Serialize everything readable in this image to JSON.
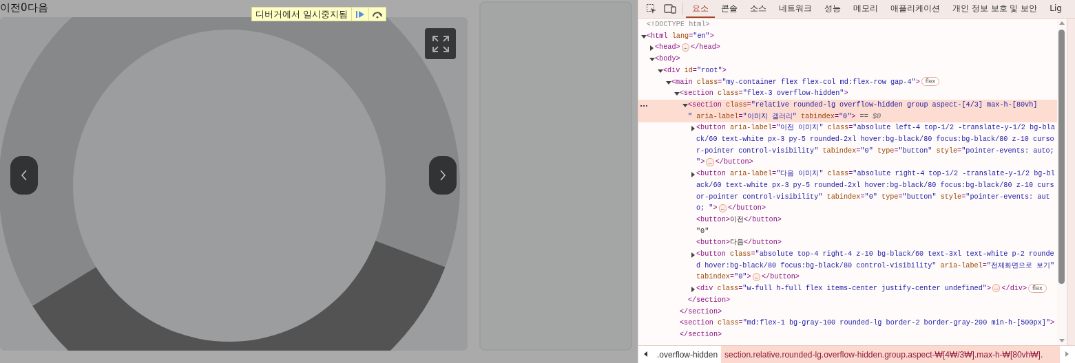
{
  "page": {
    "prev_label": "이전",
    "counter": "0",
    "next_label": "다음"
  },
  "debugger_badge": {
    "text": "디버거에서 일시중지됨"
  },
  "devtools": {
    "tabs": [
      {
        "label": "요소",
        "selected": true
      },
      {
        "label": "콘솔",
        "selected": false
      },
      {
        "label": "소스",
        "selected": false
      },
      {
        "label": "네트워크",
        "selected": false
      },
      {
        "label": "성능",
        "selected": false
      },
      {
        "label": "메모리",
        "selected": false
      },
      {
        "label": "애플리케이션",
        "selected": false
      },
      {
        "label": "개인 정보 보호 및 보안",
        "selected": false
      },
      {
        "label": "Lig",
        "selected": false
      }
    ],
    "tree": [
      {
        "segments": [
          {
            "kind": "comment",
            "text": "<!DOCTYPE html>"
          }
        ]
      },
      {
        "segments": [
          {
            "kind": "tag",
            "text": "<html"
          },
          {
            "kind": "attr",
            "text": " lang"
          },
          {
            "kind": "tag",
            "text": "="
          },
          {
            "kind": "value",
            "text": "\"en\""
          },
          {
            "kind": "tag",
            "text": ">"
          }
        ],
        "expanded": true,
        "children": [
          {
            "segments": [
              {
                "kind": "tag",
                "text": "<head>"
              },
              {
                "kind": "ellipsis",
                "text": "…"
              },
              {
                "kind": "tag",
                "text": "</head>"
              }
            ],
            "expanded": false
          },
          {
            "segments": [
              {
                "kind": "tag",
                "text": "<body>"
              }
            ],
            "expanded": true,
            "children": [
              {
                "segments": [
                  {
                    "kind": "tag",
                    "text": "<div"
                  },
                  {
                    "kind": "attr",
                    "text": " id"
                  },
                  {
                    "kind": "tag",
                    "text": "="
                  },
                  {
                    "kind": "value",
                    "text": "\"root\""
                  },
                  {
                    "kind": "tag",
                    "text": ">"
                  }
                ],
                "expanded": true,
                "children": [
                  {
                    "segments": [
                      {
                        "kind": "tag",
                        "text": "<main"
                      },
                      {
                        "kind": "attr",
                        "text": " class"
                      },
                      {
                        "kind": "tag",
                        "text": "="
                      },
                      {
                        "kind": "value",
                        "text": "\"my-container flex flex-col md:flex-row gap-4\""
                      },
                      {
                        "kind": "tag",
                        "text": ">"
                      },
                      {
                        "kind": "badge",
                        "text": "flex"
                      }
                    ],
                    "expanded": true,
                    "children": [
                      {
                        "segments": [
                          {
                            "kind": "tag",
                            "text": "<section"
                          },
                          {
                            "kind": "attr",
                            "text": " class"
                          },
                          {
                            "kind": "tag",
                            "text": "="
                          },
                          {
                            "kind": "value",
                            "text": "\"flex-3 overflow-hidden\""
                          },
                          {
                            "kind": "tag",
                            "text": ">"
                          }
                        ],
                        "expanded": true,
                        "children": [
                          {
                            "segments": [
                              {
                                "kind": "tag",
                                "text": "<section"
                              },
                              {
                                "kind": "attr",
                                "text": " class"
                              },
                              {
                                "kind": "tag",
                                "text": "="
                              },
                              {
                                "kind": "value",
                                "text": "\"relative rounded-lg overflow-hidden group aspect-[4/3] max-h-[80vh]      \""
                              },
                              {
                                "kind": "attr",
                                "text": " aria-label"
                              },
                              {
                                "kind": "tag",
                                "text": "="
                              },
                              {
                                "kind": "value",
                                "text": "\"이미지 갤러리\""
                              },
                              {
                                "kind": "attr",
                                "text": " tabindex"
                              },
                              {
                                "kind": "tag",
                                "text": "="
                              },
                              {
                                "kind": "value",
                                "text": "\"0\""
                              },
                              {
                                "kind": "tag",
                                "text": ">"
                              },
                              {
                                "kind": "ref",
                                "text": " == $0"
                              }
                            ],
                            "expanded": true,
                            "selected": true,
                            "children": [
                              {
                                "segments": [
                                  {
                                    "kind": "tag",
                                    "text": "<button"
                                  },
                                  {
                                    "kind": "attr",
                                    "text": " aria-label"
                                  },
                                  {
                                    "kind": "tag",
                                    "text": "="
                                  },
                                  {
                                    "kind": "value",
                                    "text": "\"이전 이미지\""
                                  },
                                  {
                                    "kind": "attr",
                                    "text": " class"
                                  },
                                  {
                                    "kind": "tag",
                                    "text": "="
                                  },
                                  {
                                    "kind": "value",
                                    "text": "\"absolute left-4 top-1/2 -translate-y-1/2 bg-black/60 text-white px-3 py-5 rounded-2xl hover:bg-black/80 focus:bg-black/80 z-10 cursor-pointer control-visibility\""
                                  },
                                  {
                                    "kind": "attr",
                                    "text": " tabindex"
                                  },
                                  {
                                    "kind": "tag",
                                    "text": "="
                                  },
                                  {
                                    "kind": "value",
                                    "text": "\"0\""
                                  },
                                  {
                                    "kind": "attr",
                                    "text": " type"
                                  },
                                  {
                                    "kind": "tag",
                                    "text": "="
                                  },
                                  {
                                    "kind": "value",
                                    "text": "\"button\""
                                  },
                                  {
                                    "kind": "attr",
                                    "text": " style"
                                  },
                                  {
                                    "kind": "tag",
                                    "text": "="
                                  },
                                  {
                                    "kind": "value",
                                    "text": "\"pointer-events: auto; \""
                                  },
                                  {
                                    "kind": "tag",
                                    "text": ">"
                                  },
                                  {
                                    "kind": "ellipsis",
                                    "text": "…"
                                  },
                                  {
                                    "kind": "tag",
                                    "text": "</button>"
                                  }
                                ],
                                "expanded": false
                              },
                              {
                                "segments": [
                                  {
                                    "kind": "tag",
                                    "text": "<button"
                                  },
                                  {
                                    "kind": "attr",
                                    "text": " aria-label"
                                  },
                                  {
                                    "kind": "tag",
                                    "text": "="
                                  },
                                  {
                                    "kind": "value",
                                    "text": "\"다음 이미지\""
                                  },
                                  {
                                    "kind": "attr",
                                    "text": " class"
                                  },
                                  {
                                    "kind": "tag",
                                    "text": "="
                                  },
                                  {
                                    "kind": "value",
                                    "text": "\"absolute right-4 top-1/2 -translate-y-1/2 bg-black/60 text-white px-3 py-5 rounded-2xl hover:bg-black/80 focus:bg-black/80 z-10 cursor-pointer control-visibility\""
                                  },
                                  {
                                    "kind": "attr",
                                    "text": " tabindex"
                                  },
                                  {
                                    "kind": "tag",
                                    "text": "="
                                  },
                                  {
                                    "kind": "value",
                                    "text": "\"0\""
                                  },
                                  {
                                    "kind": "attr",
                                    "text": " type"
                                  },
                                  {
                                    "kind": "tag",
                                    "text": "="
                                  },
                                  {
                                    "kind": "value",
                                    "text": "\"button\""
                                  },
                                  {
                                    "kind": "attr",
                                    "text": " style"
                                  },
                                  {
                                    "kind": "tag",
                                    "text": "="
                                  },
                                  {
                                    "kind": "value",
                                    "text": "\"pointer-events: auto; \""
                                  },
                                  {
                                    "kind": "tag",
                                    "text": ">"
                                  },
                                  {
                                    "kind": "ellipsis",
                                    "text": "…"
                                  },
                                  {
                                    "kind": "tag",
                                    "text": "</button>"
                                  }
                                ],
                                "expanded": false
                              },
                              {
                                "segments": [
                                  {
                                    "kind": "tag",
                                    "text": "<button>"
                                  },
                                  {
                                    "kind": "text",
                                    "text": "이전"
                                  },
                                  {
                                    "kind": "tag",
                                    "text": "</button>"
                                  }
                                ]
                              },
                              {
                                "segments": [
                                  {
                                    "kind": "text",
                                    "text": "\"0\""
                                  }
                                ]
                              },
                              {
                                "segments": [
                                  {
                                    "kind": "tag",
                                    "text": "<button>"
                                  },
                                  {
                                    "kind": "text",
                                    "text": "다음"
                                  },
                                  {
                                    "kind": "tag",
                                    "text": "</button>"
                                  }
                                ]
                              },
                              {
                                "segments": [
                                  {
                                    "kind": "tag",
                                    "text": "<button"
                                  },
                                  {
                                    "kind": "attr",
                                    "text": " class"
                                  },
                                  {
                                    "kind": "tag",
                                    "text": "="
                                  },
                                  {
                                    "kind": "value",
                                    "text": "\"absolute top-4 right-4 z-10 bg-black/60 text-3xl text-white p-2 rounded hover:bg-black/80 focus:bg-black/80 control-visibility\""
                                  },
                                  {
                                    "kind": "attr",
                                    "text": " aria-label"
                                  },
                                  {
                                    "kind": "tag",
                                    "text": "="
                                  },
                                  {
                                    "kind": "value",
                                    "text": "\"전체화면으로 보기\""
                                  },
                                  {
                                    "kind": "attr",
                                    "text": " tabindex"
                                  },
                                  {
                                    "kind": "tag",
                                    "text": "="
                                  },
                                  {
                                    "kind": "value",
                                    "text": "\"0\""
                                  },
                                  {
                                    "kind": "tag",
                                    "text": ">"
                                  },
                                  {
                                    "kind": "ellipsis",
                                    "text": "…"
                                  },
                                  {
                                    "kind": "tag",
                                    "text": "</button>"
                                  }
                                ],
                                "expanded": false
                              },
                              {
                                "segments": [
                                  {
                                    "kind": "tag",
                                    "text": "<div"
                                  },
                                  {
                                    "kind": "attr",
                                    "text": " class"
                                  },
                                  {
                                    "kind": "tag",
                                    "text": "="
                                  },
                                  {
                                    "kind": "value",
                                    "text": "\"w-full h-full flex items-center justify-center undefined\""
                                  },
                                  {
                                    "kind": "tag",
                                    "text": ">"
                                  },
                                  {
                                    "kind": "ellipsis",
                                    "text": "…"
                                  },
                                  {
                                    "kind": "tag",
                                    "text": "</div>"
                                  },
                                  {
                                    "kind": "badge",
                                    "text": "flex"
                                  }
                                ],
                                "expanded": false
                              }
                            ],
                            "closing": "</section>"
                          }
                        ],
                        "closing": "</section>"
                      },
                      {
                        "segments": [
                          {
                            "kind": "tag",
                            "text": "<section"
                          },
                          {
                            "kind": "attr",
                            "text": " class"
                          },
                          {
                            "kind": "tag",
                            "text": "="
                          },
                          {
                            "kind": "value",
                            "text": "\"md:flex-1 bg-gray-100 rounded-lg border-2 border-gray-200 min-h-[500px]\""
                          },
                          {
                            "kind": "tag",
                            "text": ">"
                          }
                        ],
                        "closing": "</section>"
                      }
                    ]
                  }
                ]
              }
            ]
          }
        ]
      }
    ],
    "breadcrumbs": [
      {
        "label": ".overflow-hidden",
        "selected": false
      },
      {
        "label": "section.relative.rounded-lg.overflow-hidden.group.aspect-₩[4₩/3₩].max-h-₩[80vh₩].",
        "selected": true
      }
    ]
  }
}
